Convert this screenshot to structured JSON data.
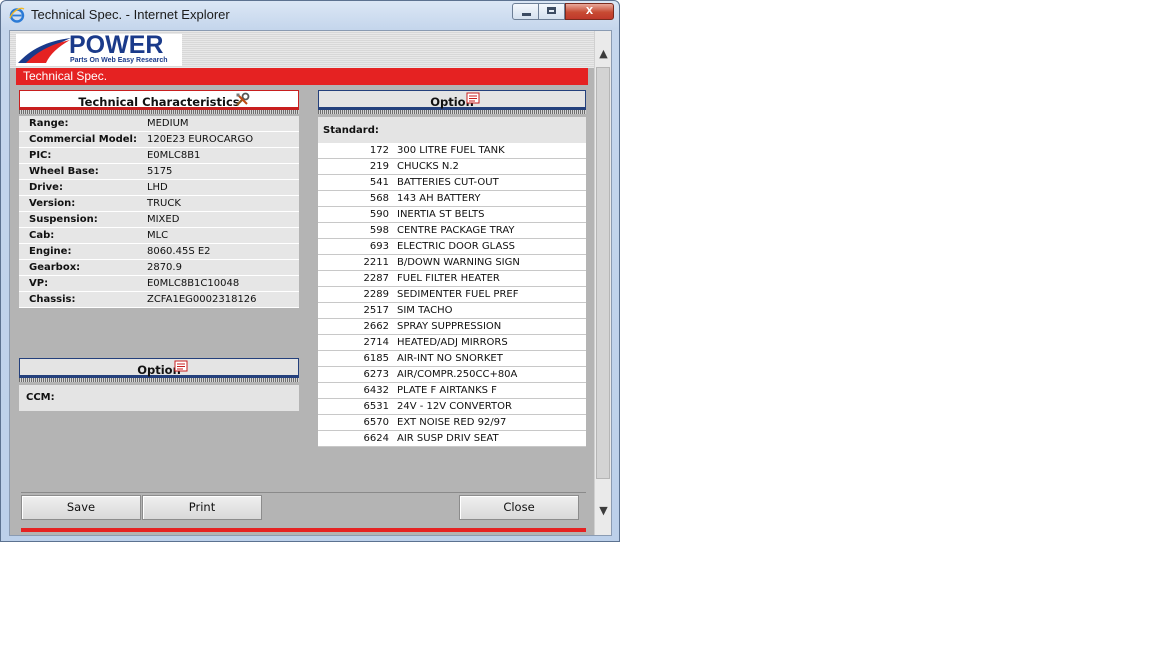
{
  "window": {
    "title": "Technical Spec. - Internet Explorer",
    "close_glyph": "x"
  },
  "logo": {
    "name": "POWER",
    "tagline": "Parts On Web Easy Research"
  },
  "header": {
    "section_title": "Technical Spec."
  },
  "tech": {
    "title": "Technical Characteristics",
    "rows": [
      {
        "label": "Range:",
        "value": "MEDIUM"
      },
      {
        "label": "Commercial Model:",
        "value": "120E23 EUROCARGO"
      },
      {
        "label": "PIC:",
        "value": "E0MLC8B1"
      },
      {
        "label": "Wheel Base:",
        "value": "5175"
      },
      {
        "label": "Drive:",
        "value": "LHD"
      },
      {
        "label": "Version:",
        "value": "TRUCK"
      },
      {
        "label": "Suspension:",
        "value": "MIXED"
      },
      {
        "label": "Cab:",
        "value": "MLC"
      },
      {
        "label": "Engine:",
        "value": "8060.45S E2"
      },
      {
        "label": "Gearbox:",
        "value": "2870.9"
      },
      {
        "label": "VP:",
        "value": "E0MLC8B1C10048"
      },
      {
        "label": "Chassis:",
        "value": "ZCFA1EG0002318126"
      }
    ]
  },
  "option_right": {
    "title": "Option",
    "standard_label": "Standard:",
    "items": [
      {
        "code": "172",
        "desc": "300 LITRE FUEL TANK"
      },
      {
        "code": "219",
        "desc": "CHUCKS N.2"
      },
      {
        "code": "541",
        "desc": "BATTERIES CUT-OUT"
      },
      {
        "code": "568",
        "desc": "143 AH BATTERY"
      },
      {
        "code": "590",
        "desc": "INERTIA ST BELTS"
      },
      {
        "code": "598",
        "desc": "CENTRE PACKAGE TRAY"
      },
      {
        "code": "693",
        "desc": "ELECTRIC DOOR GLASS"
      },
      {
        "code": "2211",
        "desc": "B/DOWN WARNING SIGN"
      },
      {
        "code": "2287",
        "desc": "FUEL FILTER HEATER"
      },
      {
        "code": "2289",
        "desc": "SEDIMENTER FUEL PREF"
      },
      {
        "code": "2517",
        "desc": "SIM TACHO"
      },
      {
        "code": "2662",
        "desc": "SPRAY SUPPRESSION"
      },
      {
        "code": "2714",
        "desc": "HEATED/ADJ MIRRORS"
      },
      {
        "code": "6185",
        "desc": "AIR-INT NO SNORKET"
      },
      {
        "code": "6273",
        "desc": "AIR/COMPR.250CC+80A"
      },
      {
        "code": "6432",
        "desc": "PLATE F AIRTANKS F"
      },
      {
        "code": "6531",
        "desc": "24V - 12V CONVERTOR"
      },
      {
        "code": "6570",
        "desc": "EXT NOISE RED 92/97"
      },
      {
        "code": "6624",
        "desc": "AIR SUSP DRIV SEAT"
      }
    ]
  },
  "option_left": {
    "title": "Option",
    "ccm_label": "CCM:"
  },
  "buttons": {
    "save": "Save",
    "print": "Print",
    "close": "Close"
  },
  "colors": {
    "accent_red": "#e52222",
    "brand_blue": "#1a3a8a",
    "panel_gray": "#b4b4b4"
  }
}
